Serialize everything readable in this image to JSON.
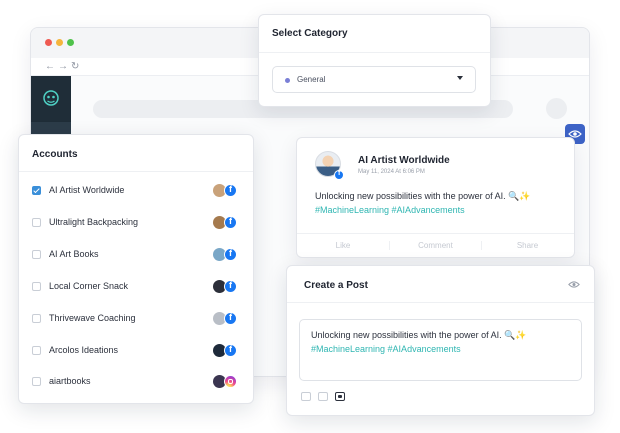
{
  "category": {
    "title": "Select Category",
    "selected": "General",
    "dot_color": "#7a7fd6"
  },
  "browser": {
    "back_icon": "arrow-left-icon",
    "forward_icon": "arrow-right-icon",
    "reload_icon": "reload-icon"
  },
  "preview": {
    "author": "AI Artist Worldwide",
    "timestamp": "May 11, 2024 At 6:06 PM",
    "text": "Unlocking new possibilities with the power of AI. 🔍✨",
    "hashtags": "#MachineLearning #AIAdvancements",
    "actions": [
      "Like",
      "Comment",
      "Share"
    ]
  },
  "accounts": {
    "title": "Accounts",
    "items": [
      {
        "name": "AI Artist Worldwide",
        "checked": true,
        "network": "facebook",
        "avatar_color": "#c9a27a"
      },
      {
        "name": "Ultralight Backpacking",
        "checked": false,
        "network": "facebook",
        "avatar_color": "#a57a4e"
      },
      {
        "name": "AI Art Books",
        "checked": false,
        "network": "facebook",
        "avatar_color": "#7aa7c7"
      },
      {
        "name": "Local Corner Snack",
        "checked": false,
        "network": "facebook",
        "avatar_color": "#2c2f3a"
      },
      {
        "name": "Thrivewave Coaching",
        "checked": false,
        "network": "facebook",
        "avatar_color": "#b9bec6"
      },
      {
        "name": "Arcolos Ideations",
        "checked": false,
        "network": "facebook",
        "avatar_color": "#1e2a3a"
      },
      {
        "name": "aiartbooks",
        "checked": false,
        "network": "instagram",
        "avatar_color": "#3a3550"
      }
    ]
  },
  "post": {
    "title": "Create a Post",
    "text": "Unlocking new possibilities with the power of AI. 🔍✨",
    "hashtags": "#MachineLearning #AIAdvancements"
  },
  "colors": {
    "accent": "#3d63c6",
    "hashtag": "#2fb6b2",
    "facebook": "#1877f2"
  }
}
